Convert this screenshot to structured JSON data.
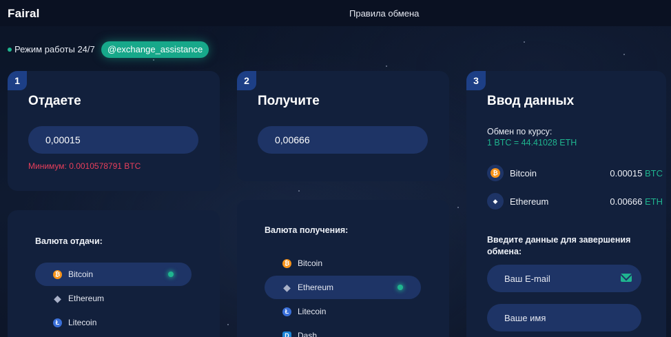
{
  "header": {
    "brand": "Fairal",
    "nav_link": "Правила обмена"
  },
  "status": {
    "work_hours": "Режим работы 24/7",
    "contact": "@exchange_assistance"
  },
  "give_card": {
    "step": "1",
    "title": "Отдаете",
    "amount": "0,00015",
    "minimum_note": "Минимум: 0.0010578791 BTC"
  },
  "receive_card": {
    "step": "2",
    "title": "Получите",
    "amount": "0,00666"
  },
  "details_card": {
    "step": "3",
    "title": "Ввод данных",
    "rate_label": "Обмен по курсу:",
    "rate_value": "1 BTC = 44.41028 ETH",
    "summary": [
      {
        "name": "Bitcoin",
        "amount": "0.00015",
        "currency": "BTC",
        "icon": "bitcoin-icon"
      },
      {
        "name": "Ethereum",
        "amount": "0.00666",
        "currency": "ETH",
        "icon": "ethereum-icon"
      }
    ],
    "enter_label": "Введите данные для завершения обмена:",
    "email_placeholder": "Ваш E-mail",
    "name_placeholder": "Ваше имя"
  },
  "give_list": {
    "title": "Валюта отдачи:",
    "items": [
      {
        "label": "Bitcoin",
        "icon": "bitcoin-icon",
        "selected": true
      },
      {
        "label": "Ethereum",
        "icon": "ethereum-icon",
        "selected": false
      },
      {
        "label": "Litecoin",
        "icon": "litecoin-icon",
        "selected": false
      }
    ]
  },
  "receive_list": {
    "title": "Валюта получения:",
    "items": [
      {
        "label": "Bitcoin",
        "icon": "bitcoin-icon",
        "selected": false
      },
      {
        "label": "Ethereum",
        "icon": "ethereum-icon",
        "selected": true
      },
      {
        "label": "Litecoin",
        "icon": "litecoin-icon",
        "selected": false
      },
      {
        "label": "Dash",
        "icon": "dash-icon",
        "selected": false
      }
    ]
  },
  "colors": {
    "accent_green": "#1fb58f",
    "error_red": "#ea3f5b",
    "card_bg": "#12203c",
    "field_bg": "#1e3466",
    "badge_blue": "#1d3f86"
  }
}
